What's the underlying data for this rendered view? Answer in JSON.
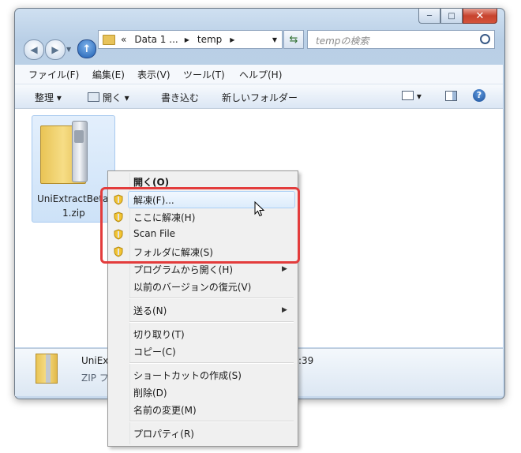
{
  "window": {
    "caption_buttons": {
      "minimize": "─",
      "maximize": "□",
      "close": "✕"
    }
  },
  "nav": {
    "back_glyph": "◀",
    "forward_glyph": "▶",
    "up_glyph": "↑",
    "address_overflow": "«",
    "breadcrumb": [
      "Data 1 ...",
      "temp"
    ],
    "search_placeholder": "tempの検索"
  },
  "menubar": [
    "ファイル(F)",
    "編集(E)",
    "表示(V)",
    "ツール(T)",
    "ヘルプ(H)"
  ],
  "toolbar": {
    "organize": "整理",
    "open": "開く",
    "burn": "書き込む",
    "new_folder": "新しいフォルダー"
  },
  "file": {
    "name_line1": "UniExtractBeta",
    "name_line2": "1.zip"
  },
  "details": {
    "name_partial": "UniEx",
    "type_partial": "ZIP フ",
    "time_partial": ":39"
  },
  "context_menu": {
    "items": [
      {
        "label": "開く(O)",
        "bold": true
      },
      {
        "label": "解凍(F)...",
        "icon": "shield-icon"
      },
      {
        "label": "ここに解凍(H)",
        "icon": "shield-icon"
      },
      {
        "label": "Scan File",
        "icon": "shield-icon"
      },
      {
        "label": "フォルダに解凍(S)",
        "icon": "shield-icon"
      },
      {
        "label": "プログラムから開く(H)",
        "submenu": true
      },
      {
        "label": "以前のバージョンの復元(V)"
      },
      {
        "label": "送る(N)",
        "submenu": true
      },
      {
        "label": "切り取り(T)"
      },
      {
        "label": "コピー(C)"
      },
      {
        "label": "ショートカットの作成(S)"
      },
      {
        "label": "削除(D)"
      },
      {
        "label": "名前の変更(M)"
      },
      {
        "label": "プロパティ(R)"
      }
    ]
  },
  "colors": {
    "highlight_box": "#e33c3c",
    "accent": "#1f5fb2"
  }
}
